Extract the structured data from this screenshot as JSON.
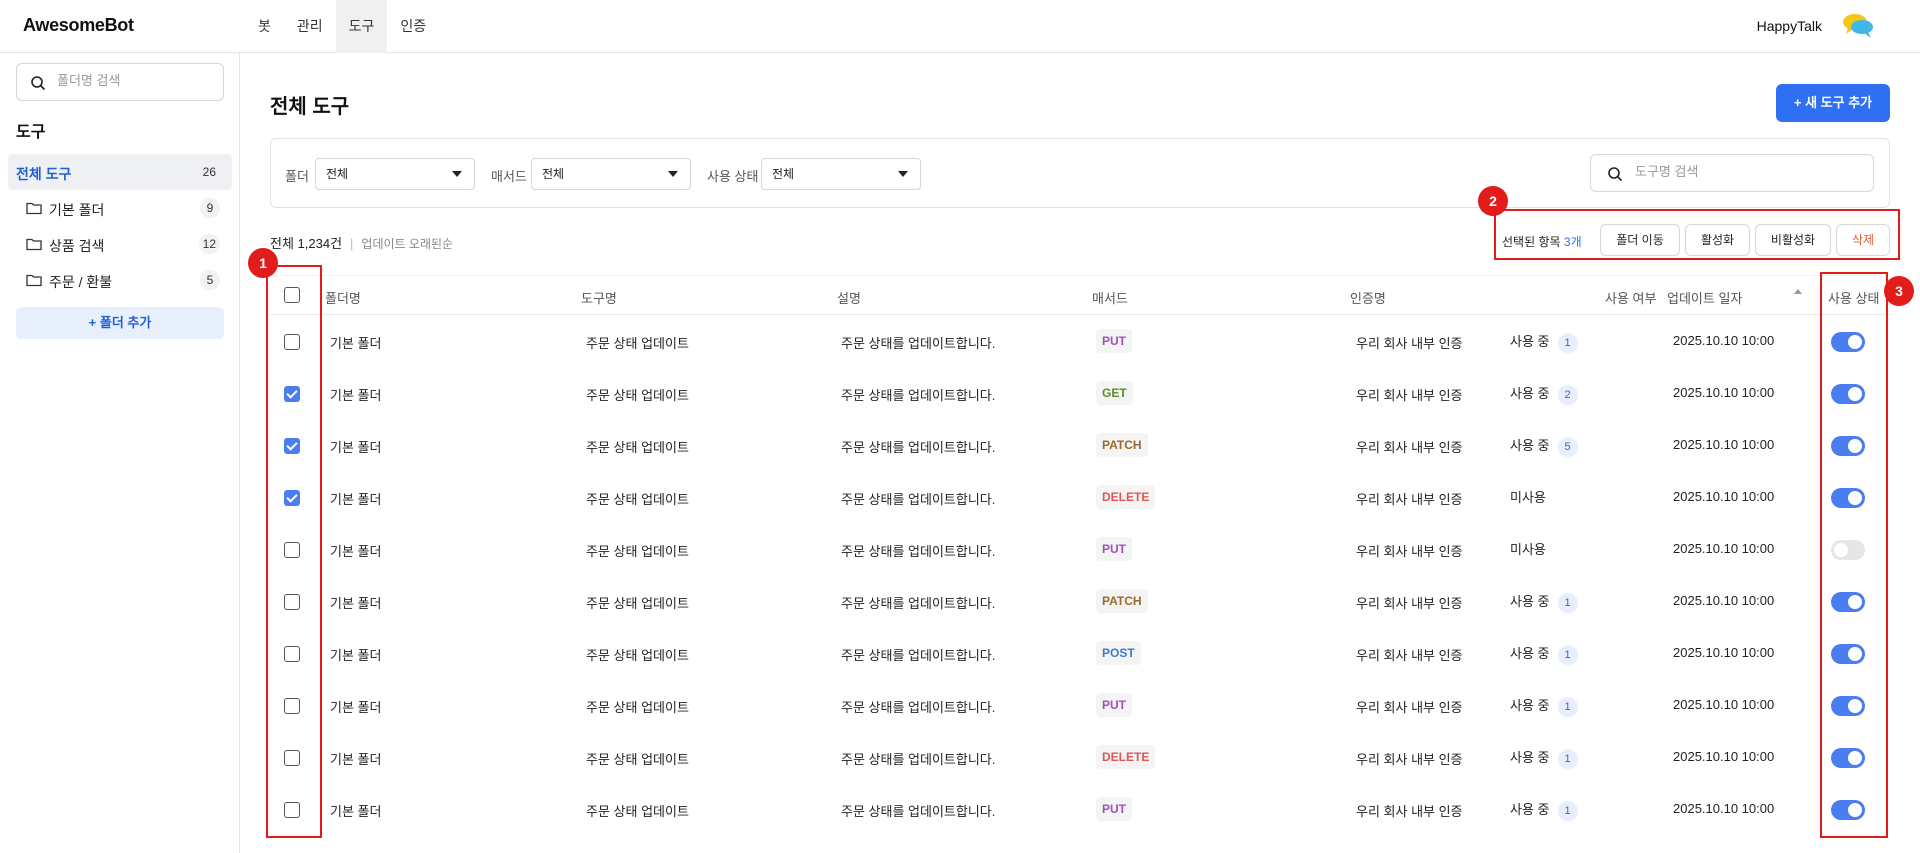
{
  "app": {
    "logo": "AwesomeBot",
    "brand": "HappyTalk"
  },
  "nav": [
    "봇",
    "관리",
    "도구",
    "인증"
  ],
  "sidebar": {
    "search_placeholder": "폴더명 검색",
    "title": "도구",
    "items": [
      {
        "label": "전체 도구",
        "count": "26"
      },
      {
        "label": "기본 폴더",
        "count": "9"
      },
      {
        "label": "상품 검색",
        "count": "12"
      },
      {
        "label": "주문 / 환불",
        "count": "5"
      }
    ],
    "add_folder": "폴더 추가"
  },
  "main": {
    "title": "전체 도구",
    "new_button": "새 도구 추가",
    "filters": {
      "folder_label": "폴더",
      "folder_value": "전체",
      "method_label": "매서드",
      "method_value": "전체",
      "status_label": "사용 상태",
      "status_value": "전체",
      "search_placeholder": "도구명 검색"
    },
    "summary": {
      "total": "전체 1,234건",
      "sort": "업데이트 오래된순"
    },
    "selection": {
      "label": "선택된 항목",
      "count": "3개",
      "move": "폴더 이동",
      "activate": "활성화",
      "deactivate": "비활성화",
      "delete": "삭제"
    },
    "annotations": [
      "1",
      "2",
      "3"
    ]
  },
  "table": {
    "headers": [
      "폴더명",
      "도구명",
      "설명",
      "매서드",
      "인증명",
      "사용 여부",
      "업데이트 일자",
      "사용 상태"
    ],
    "rows": [
      {
        "checked": false,
        "folder": "기본 폴더",
        "tool": "주문 상태 업데이트",
        "desc": "주문 상태를 업데이트합니다.",
        "method": "PUT",
        "auth": "우리 회사 내부 인증",
        "usage": "사용 중",
        "usage_count": "1",
        "date": "2025.10.10 10:00",
        "enabled": true
      },
      {
        "checked": true,
        "folder": "기본 폴더",
        "tool": "주문 상태 업데이트",
        "desc": "주문 상태를 업데이트합니다.",
        "method": "GET",
        "auth": "우리 회사 내부 인증",
        "usage": "사용 중",
        "usage_count": "2",
        "date": "2025.10.10 10:00",
        "enabled": true
      },
      {
        "checked": true,
        "folder": "기본 폴더",
        "tool": "주문 상태 업데이트",
        "desc": "주문 상태를 업데이트합니다.",
        "method": "PATCH",
        "auth": "우리 회사 내부 인증",
        "usage": "사용 중",
        "usage_count": "5",
        "date": "2025.10.10 10:00",
        "enabled": true
      },
      {
        "checked": true,
        "folder": "기본 폴더",
        "tool": "주문 상태 업데이트",
        "desc": "주문 상태를 업데이트합니다.",
        "method": "DELETE",
        "auth": "우리 회사 내부 인증",
        "usage": "미사용",
        "usage_count": "",
        "date": "2025.10.10 10:00",
        "enabled": true
      },
      {
        "checked": false,
        "folder": "기본 폴더",
        "tool": "주문 상태 업데이트",
        "desc": "주문 상태를 업데이트합니다.",
        "method": "PUT",
        "auth": "우리 회사 내부 인증",
        "usage": "미사용",
        "usage_count": "",
        "date": "2025.10.10 10:00",
        "enabled": false
      },
      {
        "checked": false,
        "folder": "기본 폴더",
        "tool": "주문 상태 업데이트",
        "desc": "주문 상태를 업데이트합니다.",
        "method": "PATCH",
        "auth": "우리 회사 내부 인증",
        "usage": "사용 중",
        "usage_count": "1",
        "date": "2025.10.10 10:00",
        "enabled": true
      },
      {
        "checked": false,
        "folder": "기본 폴더",
        "tool": "주문 상태 업데이트",
        "desc": "주문 상태를 업데이트합니다.",
        "method": "POST",
        "auth": "우리 회사 내부 인증",
        "usage": "사용 중",
        "usage_count": "1",
        "date": "2025.10.10 10:00",
        "enabled": true
      },
      {
        "checked": false,
        "folder": "기본 폴더",
        "tool": "주문 상태 업데이트",
        "desc": "주문 상태를 업데이트합니다.",
        "method": "PUT",
        "auth": "우리 회사 내부 인증",
        "usage": "사용 중",
        "usage_count": "1",
        "date": "2025.10.10 10:00",
        "enabled": true
      },
      {
        "checked": false,
        "folder": "기본 폴더",
        "tool": "주문 상태 업데이트",
        "desc": "주문 상태를 업데이트합니다.",
        "method": "DELETE",
        "auth": "우리 회사 내부 인증",
        "usage": "사용 중",
        "usage_count": "1",
        "date": "2025.10.10 10:00",
        "enabled": true
      },
      {
        "checked": false,
        "folder": "기본 폴더",
        "tool": "주문 상태 업데이트",
        "desc": "주문 상태를 업데이트합니다.",
        "method": "PUT",
        "auth": "우리 회사 내부 인증",
        "usage": "사용 중",
        "usage_count": "1",
        "date": "2025.10.10 10:00",
        "enabled": true
      }
    ]
  },
  "colors": {
    "accent": "#2f6ff2",
    "annotation": "#e21b1b",
    "methods": {
      "PUT": "#a24fb8",
      "GET": "#5a8f1e",
      "PATCH": "#9a6a2a",
      "DELETE": "#e05555",
      "POST": "#3a7bd5"
    }
  }
}
